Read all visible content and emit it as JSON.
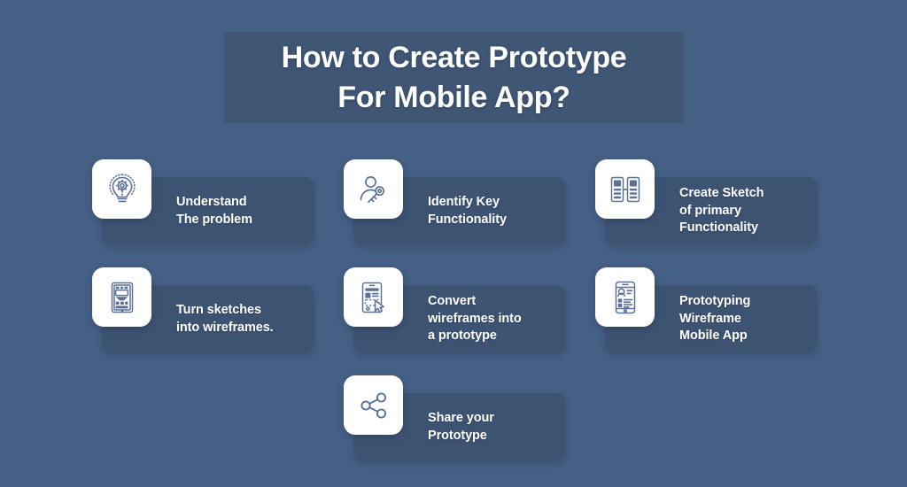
{
  "title": {
    "line1": "How to Create Prototype",
    "line2": "For Mobile App?"
  },
  "colors": {
    "background": "#456085",
    "title_box": "#3f5675",
    "card_panel": "#3d5372",
    "icon_tile": "#ffffff",
    "icon_stroke": "#5b7296",
    "text": "#ffffff"
  },
  "steps": [
    {
      "label": "Understand\nThe problem",
      "icon": "lightbulb-gear-icon"
    },
    {
      "label": "Identify Key\nFunctionality",
      "icon": "user-key-icon"
    },
    {
      "label": "Create Sketch\nof primary\nFunctionality",
      "icon": "two-screens-sketch-icon"
    },
    {
      "label": "Turn sketches\ninto wireframes.",
      "icon": "phone-wireframe-icon"
    },
    {
      "label": "Convert\nwireframes into\na prototype",
      "icon": "phone-cursor-icon"
    },
    {
      "label": "Prototyping\nWireframe\nMobile App",
      "icon": "phone-profile-icon"
    },
    {
      "label": "Share your\nPrototype",
      "icon": "share-nodes-icon"
    }
  ]
}
